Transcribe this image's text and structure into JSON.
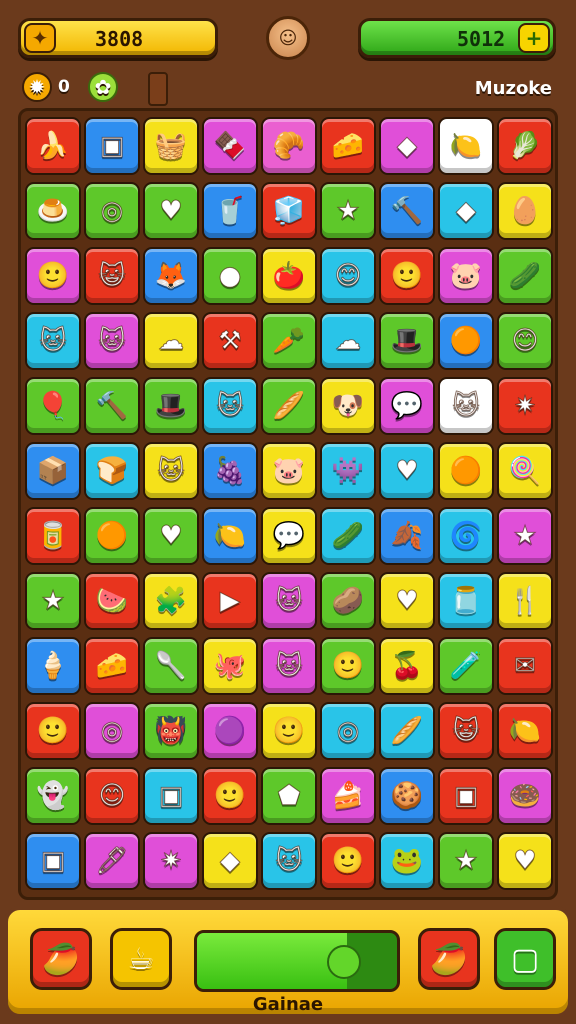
{
  "header": {
    "score_left": "3808",
    "score_right": "5012",
    "left_icon": "gold-gem-icon",
    "right_icon": "plus-icon",
    "avatar_icon": "character-avatar-icon"
  },
  "subheader": {
    "items": [
      {
        "icon": "gold-nugget-icon",
        "value": "0",
        "color": "#f5a800"
      },
      {
        "icon": "green-splat-icon",
        "value": "",
        "color": "#9be03a"
      },
      {
        "icon": "chocolate-bar-icon",
        "value": "",
        "color": "#7a3e1a"
      }
    ],
    "title": "Muzoke"
  },
  "board": {
    "columns": 9,
    "rows": [
      [
        {
          "color": "#e8341e",
          "icon": "🍌"
        },
        {
          "color": "#2f8ef0",
          "icon": "▣"
        },
        {
          "color": "#f5e11a",
          "icon": "🧺"
        },
        {
          "color": "#e04fd8",
          "icon": "🍫"
        },
        {
          "color": "#ea5fd0",
          "icon": "🥐"
        },
        {
          "color": "#e8341e",
          "icon": "🧀"
        },
        {
          "color": "#e04fd8",
          "icon": "◆"
        },
        {
          "color": "#ffffff",
          "icon": "🍋"
        },
        {
          "color": "#e8341e",
          "icon": "🥬"
        }
      ],
      [
        {
          "color": "#5ec82a",
          "icon": "🍮"
        },
        {
          "color": "#5ec82a",
          "icon": "◎"
        },
        {
          "color": "#5ec82a",
          "icon": "♥"
        },
        {
          "color": "#2f8ef0",
          "icon": "🥤"
        },
        {
          "color": "#e8341e",
          "icon": "🧊"
        },
        {
          "color": "#5ec82a",
          "icon": "★"
        },
        {
          "color": "#2f8ef0",
          "icon": "🔨"
        },
        {
          "color": "#29c4e8",
          "icon": "◆"
        },
        {
          "color": "#f5e11a",
          "icon": "🥚"
        }
      ],
      [
        {
          "color": "#e04fd8",
          "icon": "🙂"
        },
        {
          "color": "#e8341e",
          "icon": "😺"
        },
        {
          "color": "#2f8ef0",
          "icon": "🦊"
        },
        {
          "color": "#5ec82a",
          "icon": "●"
        },
        {
          "color": "#f5e11a",
          "icon": "🍅"
        },
        {
          "color": "#29c4e8",
          "icon": "😊"
        },
        {
          "color": "#e8341e",
          "icon": "🙂"
        },
        {
          "color": "#e04fd8",
          "icon": "🐷"
        },
        {
          "color": "#5ec82a",
          "icon": "🥒"
        }
      ],
      [
        {
          "color": "#29c4e8",
          "icon": "🐱"
        },
        {
          "color": "#e04fd8",
          "icon": "🐱"
        },
        {
          "color": "#f5e11a",
          "icon": "☁"
        },
        {
          "color": "#e8341e",
          "icon": "⚒"
        },
        {
          "color": "#5ec82a",
          "icon": "🥕"
        },
        {
          "color": "#29c4e8",
          "icon": "☁"
        },
        {
          "color": "#5ec82a",
          "icon": "🎩"
        },
        {
          "color": "#2f8ef0",
          "icon": "🟠"
        },
        {
          "color": "#5ec82a",
          "icon": "😊"
        }
      ],
      [
        {
          "color": "#5ec82a",
          "icon": "🎈"
        },
        {
          "color": "#5ec82a",
          "icon": "🔨"
        },
        {
          "color": "#5ec82a",
          "icon": "🎩"
        },
        {
          "color": "#29c4e8",
          "icon": "🐱"
        },
        {
          "color": "#5ec82a",
          "icon": "🥖"
        },
        {
          "color": "#f5e11a",
          "icon": "🐶"
        },
        {
          "color": "#e04fd8",
          "icon": "💬"
        },
        {
          "color": "#ffffff",
          "icon": "🐱"
        },
        {
          "color": "#e8341e",
          "icon": "✷"
        }
      ],
      [
        {
          "color": "#2f8ef0",
          "icon": "📦"
        },
        {
          "color": "#29c4e8",
          "icon": "🍞"
        },
        {
          "color": "#f5e11a",
          "icon": "🐱"
        },
        {
          "color": "#2f8ef0",
          "icon": "🍇"
        },
        {
          "color": "#f5e11a",
          "icon": "🐷"
        },
        {
          "color": "#29c4e8",
          "icon": "👾"
        },
        {
          "color": "#29c4e8",
          "icon": "♥"
        },
        {
          "color": "#f5e11a",
          "icon": "🟠"
        },
        {
          "color": "#f5e11a",
          "icon": "🍭"
        }
      ],
      [
        {
          "color": "#e8341e",
          "icon": "🥫"
        },
        {
          "color": "#5ec82a",
          "icon": "🟠"
        },
        {
          "color": "#5ec82a",
          "icon": "♥"
        },
        {
          "color": "#2f8ef0",
          "icon": "🍋"
        },
        {
          "color": "#f5e11a",
          "icon": "💬"
        },
        {
          "color": "#29c4e8",
          "icon": "🥒"
        },
        {
          "color": "#2f8ef0",
          "icon": "🍂"
        },
        {
          "color": "#29c4e8",
          "icon": "🌀"
        },
        {
          "color": "#e04fd8",
          "icon": "★"
        }
      ],
      [
        {
          "color": "#5ec82a",
          "icon": "★"
        },
        {
          "color": "#e8341e",
          "icon": "🍉"
        },
        {
          "color": "#f5e11a",
          "icon": "🧩"
        },
        {
          "color": "#e8341e",
          "icon": "▶"
        },
        {
          "color": "#e04fd8",
          "icon": "🐱"
        },
        {
          "color": "#5ec82a",
          "icon": "🥔"
        },
        {
          "color": "#f5e11a",
          "icon": "♥"
        },
        {
          "color": "#29c4e8",
          "icon": "🫙"
        },
        {
          "color": "#f5e11a",
          "icon": "🍴"
        }
      ],
      [
        {
          "color": "#2f8ef0",
          "icon": "🍦"
        },
        {
          "color": "#e8341e",
          "icon": "🧀"
        },
        {
          "color": "#5ec82a",
          "icon": "🥄"
        },
        {
          "color": "#f5e11a",
          "icon": "🐙"
        },
        {
          "color": "#e04fd8",
          "icon": "🐱"
        },
        {
          "color": "#5ec82a",
          "icon": "🙂"
        },
        {
          "color": "#f5e11a",
          "icon": "🍒"
        },
        {
          "color": "#5ec82a",
          "icon": "🧪"
        },
        {
          "color": "#e8341e",
          "icon": "✉"
        }
      ],
      [
        {
          "color": "#e8341e",
          "icon": "🙂"
        },
        {
          "color": "#e04fd8",
          "icon": "◎"
        },
        {
          "color": "#5ec82a",
          "icon": "👹"
        },
        {
          "color": "#e04fd8",
          "icon": "🟣"
        },
        {
          "color": "#f5e11a",
          "icon": "🙂"
        },
        {
          "color": "#29c4e8",
          "icon": "◎"
        },
        {
          "color": "#29c4e8",
          "icon": "🥖"
        },
        {
          "color": "#e8341e",
          "icon": "😺"
        },
        {
          "color": "#e8341e",
          "icon": "🍋"
        }
      ],
      [
        {
          "color": "#5ec82a",
          "icon": "👻"
        },
        {
          "color": "#e8341e",
          "icon": "😊"
        },
        {
          "color": "#29c4e8",
          "icon": "▣"
        },
        {
          "color": "#e8341e",
          "icon": "🙂"
        },
        {
          "color": "#5ec82a",
          "icon": "⬟"
        },
        {
          "color": "#e04fd8",
          "icon": "🍰"
        },
        {
          "color": "#2f8ef0",
          "icon": "🍪"
        },
        {
          "color": "#e8341e",
          "icon": "▣"
        },
        {
          "color": "#e04fd8",
          "icon": "🍩"
        }
      ],
      [
        {
          "color": "#2f8ef0",
          "icon": "▣"
        },
        {
          "color": "#e04fd8",
          "icon": "🖊"
        },
        {
          "color": "#e04fd8",
          "icon": "✷"
        },
        {
          "color": "#f5e11a",
          "icon": "◆"
        },
        {
          "color": "#29c4e8",
          "icon": "🐱"
        },
        {
          "color": "#e8341e",
          "icon": "🙂"
        },
        {
          "color": "#29c4e8",
          "icon": "🐸"
        },
        {
          "color": "#5ec82a",
          "icon": "★"
        },
        {
          "color": "#f5e11a",
          "icon": "♥"
        }
      ]
    ]
  },
  "footer": {
    "left_button_icon": "cacao-pod-icon",
    "second_button_icon": "coffee-cup-icon",
    "progress": 0.75,
    "right_button_icon": "cacao-pod-icon",
    "last_button_icon": "sugar-cube-icon",
    "label": "Gainae",
    "colors": {
      "red_button": "#e8341e",
      "green_button": "#3fbf2a",
      "yellow_button": "#f5c400"
    }
  }
}
